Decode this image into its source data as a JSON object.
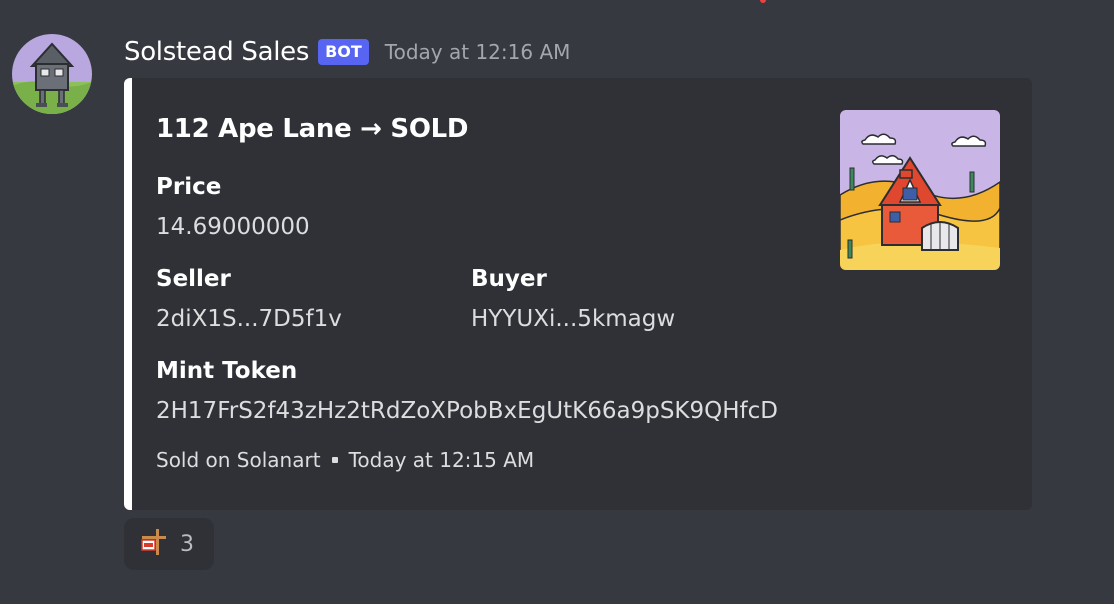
{
  "message": {
    "author": "Solstead Sales",
    "bot_tag": "BOT",
    "timestamp": "Today at 12:16 AM",
    "avatar_icon": "walking-house-avatar"
  },
  "embed": {
    "accent_color": "#ffffff",
    "title": "112 Ape Lane → SOLD",
    "fields": {
      "price": {
        "name": "Price",
        "value": "14.69000000"
      },
      "seller": {
        "name": "Seller",
        "value": "2diX1S...7D5f1v"
      },
      "buyer": {
        "name": "Buyer",
        "value": "HYYUXi...5kmagw"
      },
      "mint": {
        "name": "Mint Token",
        "value": "2H17FrS2f43zHz2tRdZoXPobBxEgUtK66a9pSK9QHfcD"
      }
    },
    "footer": {
      "source": "Sold on Solanart",
      "time": "Today at 12:15 AM"
    },
    "thumbnail_icon": "desert-house-thumbnail"
  },
  "reaction": {
    "emoji_icon": "for-sale-sign-emoji",
    "count": "3"
  }
}
